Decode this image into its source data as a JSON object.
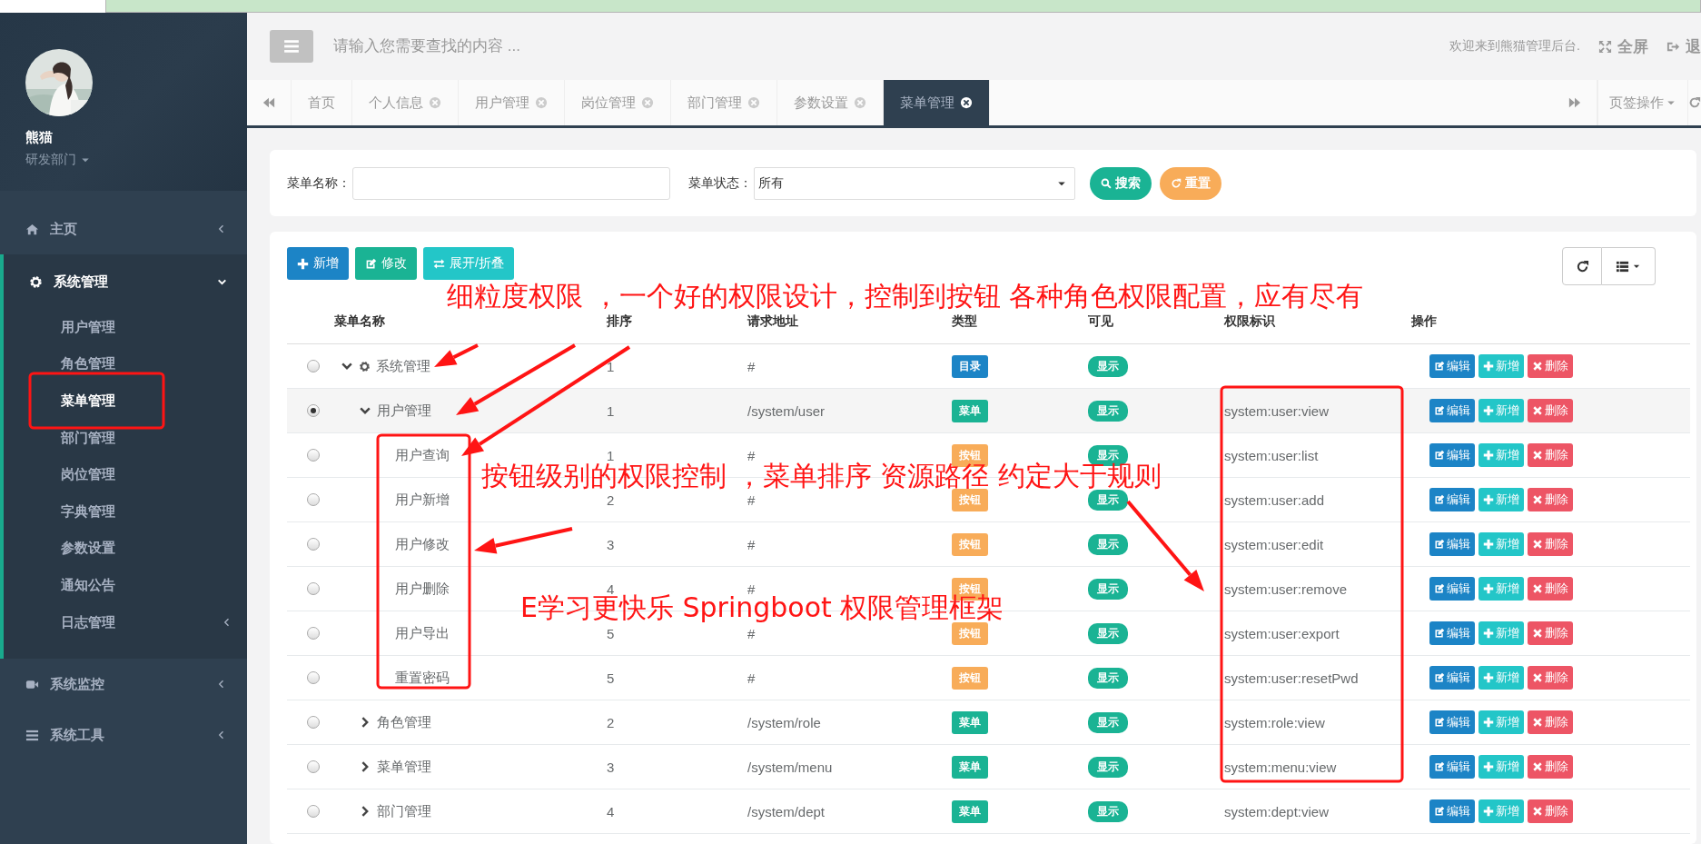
{
  "user": {
    "name": "熊猫",
    "dept": "研发部门"
  },
  "sidebar": {
    "items": [
      {
        "label": "主页",
        "expanded": false
      },
      {
        "label": "系统管理",
        "expanded": true,
        "children": [
          {
            "label": "用户管理",
            "selected": false,
            "kind": "page"
          },
          {
            "label": "角色管理",
            "selected": false,
            "kind": "page"
          },
          {
            "label": "菜单管理",
            "selected": true,
            "kind": "page"
          },
          {
            "label": "部门管理",
            "selected": false,
            "kind": "page"
          },
          {
            "label": "岗位管理",
            "selected": false,
            "kind": "page"
          },
          {
            "label": "字典管理",
            "selected": false,
            "kind": "page"
          },
          {
            "label": "参数设置",
            "selected": false,
            "kind": "page"
          },
          {
            "label": "通知公告",
            "selected": false,
            "kind": "page"
          },
          {
            "label": "日志管理",
            "selected": false,
            "kind": "folder"
          }
        ]
      },
      {
        "label": "系统监控",
        "expanded": false
      },
      {
        "label": "系统工具",
        "expanded": false
      }
    ]
  },
  "header": {
    "search_placeholder": "请输入您需要查找的内容 ...",
    "welcome": "欢迎来到熊猫管理后台.",
    "fullscreen": "全屏",
    "logout": "退"
  },
  "tabs": [
    {
      "label": "首页",
      "closable": false,
      "selected": false
    },
    {
      "label": "个人信息",
      "closable": true,
      "selected": false
    },
    {
      "label": "用户管理",
      "closable": true,
      "selected": false
    },
    {
      "label": "岗位管理",
      "closable": true,
      "selected": false
    },
    {
      "label": "部门管理",
      "closable": true,
      "selected": false
    },
    {
      "label": "参数设置",
      "closable": true,
      "selected": false
    },
    {
      "label": "菜单管理",
      "closable": true,
      "selected": true
    }
  ],
  "tab_actions": "页签操作",
  "search_form": {
    "name_label": "菜单名称：",
    "status_label": "菜单状态：",
    "status_value": "所有",
    "search_button": "搜索",
    "reset_button": "重置"
  },
  "toolbar": [
    "新增",
    "修改",
    "展开/折叠"
  ],
  "table": {
    "columns": [
      "菜单名称",
      "排序",
      "请求地址",
      "类型",
      "可见",
      "权限标识",
      "操作"
    ],
    "rows": [
      {
        "name": "系统管理",
        "kind": "directory",
        "expanded": true,
        "selected": false,
        "order": "1",
        "url": "#",
        "type_label": "目录",
        "visible": "显示",
        "actions": [
          "编辑",
          "新增",
          "删除"
        ],
        "children": [
          {
            "name": "用户管理",
            "kind": "menu",
            "expanded": true,
            "selected": true,
            "order": "1",
            "url": "/system/user",
            "type_label": "菜单",
            "visible": "显示",
            "perm": "system:user:view",
            "actions": [
              "编辑",
              "新增",
              "删除"
            ],
            "children": [
              {
                "name": "用户查询",
                "kind": "button",
                "selected": false,
                "order": "1",
                "url": "#",
                "type_label": "按钮",
                "visible": "显示",
                "perm": "system:user:list",
                "actions": [
                  "编辑",
                  "新增",
                  "删除"
                ]
              },
              {
                "name": "用户新增",
                "kind": "button",
                "selected": false,
                "order": "2",
                "url": "#",
                "type_label": "按钮",
                "visible": "显示",
                "perm": "system:user:add",
                "actions": [
                  "编辑",
                  "新增",
                  "删除"
                ]
              },
              {
                "name": "用户修改",
                "kind": "button",
                "selected": false,
                "order": "3",
                "url": "#",
                "type_label": "按钮",
                "visible": "显示",
                "perm": "system:user:edit",
                "actions": [
                  "编辑",
                  "新增",
                  "删除"
                ]
              },
              {
                "name": "用户删除",
                "kind": "button",
                "selected": false,
                "order": "4",
                "url": "#",
                "type_label": "按钮",
                "visible": "显示",
                "perm": "system:user:remove",
                "actions": [
                  "编辑",
                  "新增",
                  "删除"
                ]
              },
              {
                "name": "用户导出",
                "kind": "button",
                "selected": false,
                "order": "5",
                "url": "#",
                "type_label": "按钮",
                "visible": "显示",
                "perm": "system:user:export",
                "actions": [
                  "编辑",
                  "新增",
                  "删除"
                ]
              },
              {
                "name": "重置密码",
                "kind": "button",
                "selected": false,
                "order": "5",
                "url": "#",
                "type_label": "按钮",
                "visible": "显示",
                "perm": "system:user:resetPwd",
                "actions": [
                  "编辑",
                  "新增",
                  "删除"
                ]
              }
            ]
          },
          {
            "name": "角色管理",
            "kind": "menu",
            "expanded": false,
            "selected": false,
            "order": "2",
            "url": "/system/role",
            "type_label": "菜单",
            "visible": "显示",
            "perm": "system:role:view",
            "actions": [
              "编辑",
              "新增",
              "删除"
            ]
          },
          {
            "name": "菜单管理",
            "kind": "menu",
            "expanded": false,
            "selected": false,
            "order": "3",
            "url": "/system/menu",
            "type_label": "菜单",
            "visible": "显示",
            "perm": "system:menu:view",
            "actions": [
              "编辑",
              "新增",
              "删除"
            ]
          },
          {
            "name": "部门管理",
            "kind": "menu",
            "expanded": false,
            "selected": false,
            "order": "4",
            "url": "/system/dept",
            "type_label": "菜单",
            "visible": "显示",
            "perm": "system:dept:view",
            "actions": [
              "编辑",
              "新增",
              "删除"
            ]
          }
        ]
      }
    ]
  },
  "annotations": [
    "细粒度权限 ，一个好的权限设计，控制到按钮 各种角色权限配置，应有尽有",
    "按钮级别的权限控制 ，菜单排序 资源路径 约定大于规则",
    "E学习更快乐 Springboot 权限管理框架"
  ]
}
